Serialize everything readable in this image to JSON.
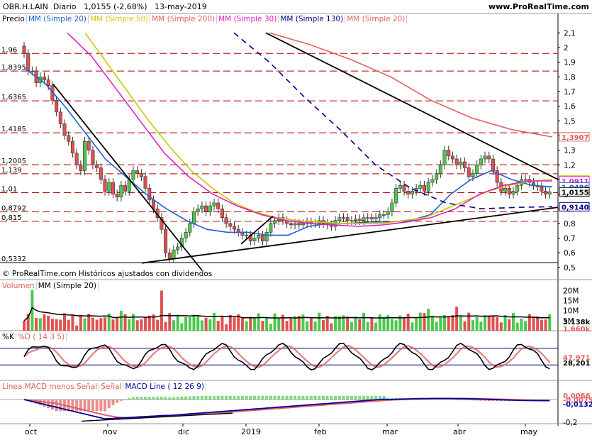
{
  "header": {
    "symbol": "OBR.H.LAIN",
    "period": "Diario",
    "price": "1,0155",
    "change": "(-2,68%)",
    "date": "13-may-2019",
    "site": "www.ProRealTime.com"
  },
  "credit": "© ProRealTime.com  Históricos ajustados con dividendos",
  "panel_labels": {
    "price": [
      {
        "text": "Precio",
        "color": "#000000"
      },
      {
        "text": "MM (Simple 20)",
        "color": "#2060d0"
      },
      {
        "text": "MM (Simple 50)",
        "color": "#c8c800"
      },
      {
        "text": "MM (Simple 200)",
        "color": "#e06060"
      },
      {
        "text": "MM (Simple 30)",
        "color": "#e020c0"
      },
      {
        "text": "MM (Simple 130)",
        "color": "#000080"
      },
      {
        "text": "MM (Simple 20)",
        "color": "#e06060"
      }
    ],
    "volume": [
      {
        "text": "Volumen",
        "color": "#e06060"
      },
      {
        "text": "MM (Simple 20)",
        "color": "#000000"
      }
    ],
    "stoch": [
      {
        "text": "%K",
        "color": "#000000"
      },
      {
        "text": "%D ( 14 3 5)",
        "color": "#e06060"
      }
    ],
    "macd": [
      {
        "text": "Linea MACD menos Señal",
        "color": "#e06060"
      },
      {
        "text": "Señal",
        "color": "#e06060"
      },
      {
        "text": "MACD Line ( 12 26 9)",
        "color": "#0000a0"
      }
    ]
  },
  "chart_data": [
    {
      "type": "candlestick",
      "panel": "price",
      "x_months": [
        "oct",
        "nov",
        "dic",
        "2019",
        "feb",
        "mar",
        "abr",
        "may"
      ],
      "y_ticks": [
        0.5,
        0.6,
        0.7,
        0.8,
        0.9,
        1.0,
        1.1,
        1.2,
        1.3,
        1.4,
        1.5,
        1.6,
        1.7,
        1.8,
        1.9,
        2.0,
        2.1
      ],
      "y_tick_labels": [
        "0,5",
        "0,6",
        "0,7",
        "0,8",
        "0,9",
        "1",
        "1,1",
        "1,2",
        "1,3",
        "1,4",
        "1,5",
        "1,6",
        "1,7",
        "1,8",
        "1,9",
        "2",
        "2,1"
      ],
      "ylim": [
        0.48,
        2.15
      ],
      "horizontal_levels": [
        {
          "value": 1.96,
          "label": "1,96"
        },
        {
          "value": 1.8395,
          "label": "1,8395"
        },
        {
          "value": 1.6365,
          "label": "1,6365"
        },
        {
          "value": 1.4185,
          "label": "1,4185"
        },
        {
          "value": 1.2005,
          "label": "1,2005"
        },
        {
          "value": 1.139,
          "label": "1,139"
        },
        {
          "value": 1.01,
          "label": "1,01"
        },
        {
          "value": 0.8792,
          "label": "0,8792"
        },
        {
          "value": 0.815,
          "label": "0,815"
        },
        {
          "value": 0.5332,
          "label": "0,5332"
        }
      ],
      "value_tags": [
        {
          "value": 1.3907,
          "label": "1,3907",
          "color": "#e06060"
        },
        {
          "value": 1.0978,
          "label": "1,0978",
          "color": "#c8c800"
        },
        {
          "value": 1.0911,
          "label": "1,0911",
          "color": "#e020c0"
        },
        {
          "value": 1.0486,
          "label": "1,0486",
          "color": "#2060d0"
        },
        {
          "value": 1.0155,
          "label": "1,0155",
          "color": "#000000"
        },
        {
          "value": 0.914,
          "label": "0,9140",
          "color": "#000080"
        }
      ],
      "closes": [
        1.96,
        1.84,
        1.84,
        1.76,
        1.8,
        1.78,
        1.74,
        1.64,
        1.56,
        1.48,
        1.4,
        1.36,
        1.28,
        1.2,
        1.16,
        1.36,
        1.3,
        1.2,
        1.18,
        1.1,
        1.02,
        1.08,
        1.0,
        0.98,
        1.06,
        1.02,
        1.1,
        1.16,
        1.14,
        1.12,
        1.04,
        0.96,
        0.9,
        0.84,
        0.76,
        0.6,
        0.56,
        0.62,
        0.64,
        0.7,
        0.74,
        0.8,
        0.88,
        0.9,
        0.92,
        0.88,
        0.92,
        0.94,
        0.9,
        0.84,
        0.8,
        0.78,
        0.76,
        0.74,
        0.72,
        0.72,
        0.68,
        0.7,
        0.72,
        0.68,
        0.74,
        0.8,
        0.82,
        0.84,
        0.82,
        0.8,
        0.79,
        0.8,
        0.79,
        0.8,
        0.81,
        0.8,
        0.8,
        0.82,
        0.8,
        0.79,
        0.78,
        0.82,
        0.84,
        0.84,
        0.82,
        0.82,
        0.83,
        0.82,
        0.84,
        0.84,
        0.83,
        0.84,
        0.86,
        0.86,
        0.88,
        0.94,
        1.04,
        1.06,
        1.02,
        1.0,
        1.02,
        1.04,
        1.06,
        1.02,
        1.08,
        1.1,
        1.14,
        1.2,
        1.3,
        1.26,
        1.24,
        1.2,
        1.22,
        1.18,
        1.12,
        1.14,
        1.2,
        1.24,
        1.26,
        1.24,
        1.16,
        1.08,
        1.02,
        1.04,
        1.0,
        1.02,
        1.06,
        1.1,
        1.1,
        1.08,
        1.06,
        1.05,
        1.02,
        1.0,
        1.0155
      ],
      "series": [
        {
          "name": "MM (Simple 20)",
          "color": "#2060d0",
          "values": [
            1.86,
            1.76,
            1.6,
            1.42,
            1.24,
            1.12,
            1.0,
            0.9,
            0.82,
            0.76,
            0.74,
            0.74,
            0.72,
            0.72,
            0.78,
            0.8,
            0.8,
            0.81,
            0.81,
            0.82,
            0.86,
            1.0,
            1.1,
            1.16,
            1.1,
            1.06,
            1.05
          ]
        },
        {
          "name": "MM (Simple 50)",
          "color": "#c8c800",
          "values": [
            2.1,
            1.9,
            1.7,
            1.5,
            1.32,
            1.16,
            1.04,
            0.94,
            0.88,
            0.84,
            0.82,
            0.81,
            0.8,
            0.8,
            0.8,
            0.82,
            0.84,
            0.9,
            0.96,
            1.02,
            1.06,
            1.09,
            1.1
          ]
        },
        {
          "name": "MM (Simple 30)",
          "color": "#e020c0",
          "values": [
            2.1,
            1.94,
            1.72,
            1.5,
            1.28,
            1.12,
            1.0,
            0.92,
            0.86,
            0.82,
            0.8,
            0.79,
            0.78,
            0.79,
            0.81,
            0.84,
            0.9,
            1.0,
            1.06,
            1.09,
            1.09
          ]
        },
        {
          "name": "MM (Simple 200)",
          "color": "#e06060",
          "values": [
            2.1,
            2.02,
            1.92,
            1.8,
            1.64,
            1.52,
            1.44,
            1.39
          ]
        },
        {
          "name": "MM (Simple 130)",
          "color": "#000080",
          "values": [
            2.1,
            1.9,
            1.66,
            1.44,
            1.2,
            1.04,
            0.94,
            0.9,
            0.91,
            0.914
          ]
        }
      ]
    },
    {
      "type": "bar",
      "panel": "volume",
      "y_tick_labels": [
        "20M",
        "15M",
        "10M",
        "5M"
      ],
      "value_tags": [
        {
          "label": "3.138k",
          "color": "#000000"
        },
        {
          "label": "1.660k",
          "color": "#e06060"
        }
      ],
      "ylim": [
        0,
        23
      ],
      "unit": "M"
    },
    {
      "type": "line",
      "panel": "stochastic",
      "series_names": [
        "%K",
        "%D ( 14 3 5)"
      ],
      "value_tags": [
        {
          "value": 47.971,
          "label": "47,971",
          "color": "#e06060"
        },
        {
          "value": 28.201,
          "label": "28,201",
          "color": "#000000"
        }
      ],
      "ylim": [
        0,
        100
      ]
    },
    {
      "type": "line",
      "panel": "macd",
      "y_tick_labels": [
        "-0,2"
      ],
      "value_tags": [
        {
          "value": 0.0066,
          "label": "0,0066",
          "color": "#e06060"
        },
        {
          "value": -0.0075,
          "label": "-0,0075",
          "color": "#e06060"
        },
        {
          "value": -0.0132,
          "label": "-0,0132",
          "color": "#0000a0"
        }
      ]
    }
  ]
}
